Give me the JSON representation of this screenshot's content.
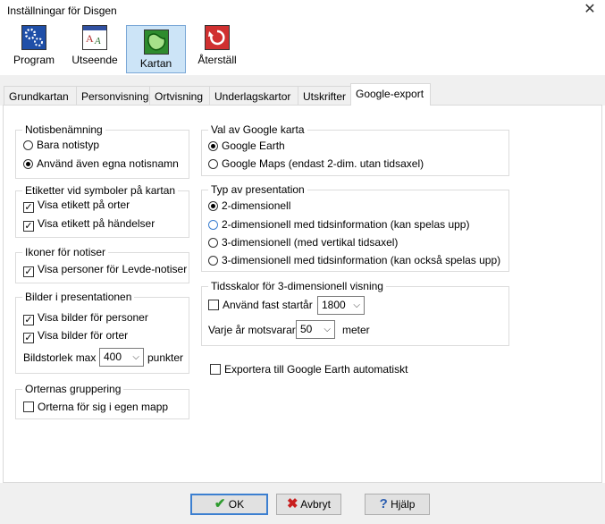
{
  "window": {
    "title": "Inställningar för Disgen",
    "close_glyph": "✕"
  },
  "toolbar": {
    "items": [
      {
        "label": "Program",
        "icon": "gear-icon",
        "color": "#1f4fa8"
      },
      {
        "label": "Utseende",
        "icon": "font-icon",
        "color": "#3050a0"
      },
      {
        "label": "Kartan",
        "icon": "map-icon",
        "color": "#2e8b2e",
        "active": true
      },
      {
        "label": "Återställ",
        "icon": "reset-icon",
        "color": "#d03030"
      }
    ]
  },
  "tabs": [
    "Grundkartan",
    "Personvisning",
    "Ortvisning",
    "Underlagskartor",
    "Utskrifter",
    "Google-export"
  ],
  "notis": {
    "title": "Notisbenämning",
    "opt1": "Bara notistyp",
    "opt2": "Använd även egna notisnamn"
  },
  "etiketter": {
    "title": "Etiketter vid symboler på kartan",
    "opt1": "Visa etikett på orter",
    "opt2": "Visa etikett på händelser"
  },
  "ikoner": {
    "title": "Ikoner för notiser",
    "opt1": "Visa personer för Levde-notiser"
  },
  "bilder": {
    "title": "Bilder i presentationen",
    "opt1": "Visa bilder för personer",
    "opt2": "Visa bilder för orter",
    "size_label": "Bildstorlek max",
    "size_value": "400",
    "size_unit": "punkter"
  },
  "grupp": {
    "title": "Orternas gruppering",
    "opt1": "Orterna för sig i egen mapp"
  },
  "karta": {
    "title": "Val av Google karta",
    "opt1": "Google Earth",
    "opt2": "Google Maps (endast 2-dim. utan tidsaxel)"
  },
  "typ": {
    "title": "Typ av presentation",
    "opt1": "2-dimensionell",
    "opt2": "2-dimensionell med tidsinformation (kan spelas upp)",
    "opt3": "3-dimensionell (med vertikal tidsaxel)",
    "opt4": "3-dimensionell med tidsinformation (kan också spelas upp)"
  },
  "tidsskalor": {
    "title": "Tidsskalor för 3-dimensionell visning",
    "fixed_label": "Använd fast startår",
    "fixed_value": "1800",
    "year_label": "Varje år motsvarar",
    "year_value": "50",
    "year_unit": "meter"
  },
  "export": {
    "label": "Exportera till Google Earth automatiskt"
  },
  "buttons": {
    "ok": "OK",
    "cancel": "Avbryt",
    "help": "Hjälp"
  }
}
